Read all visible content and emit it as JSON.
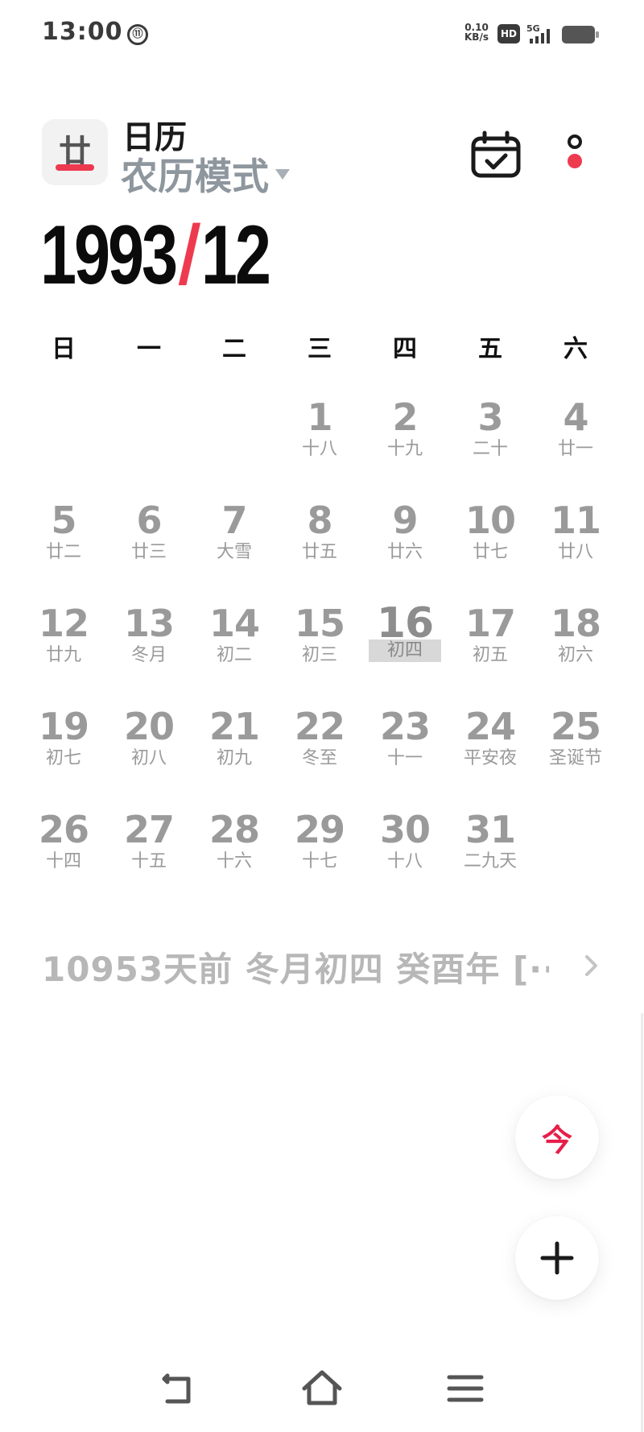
{
  "status_bar": {
    "time": "13:00",
    "time_badge": "⑪",
    "net_speed_value": "0.10",
    "net_speed_unit": "KB/s",
    "hd_label": "HD",
    "signal_label": "5G"
  },
  "header": {
    "app_icon_glyph": "廿",
    "app_title": "日历",
    "mode_label": "农历模式",
    "year": "1993",
    "month": "12",
    "accent_color": "#ee3a4f"
  },
  "weekdays": [
    "日",
    "一",
    "二",
    "三",
    "四",
    "五",
    "六"
  ],
  "calendar": {
    "leading_blanks": 3,
    "selected_day": "16",
    "days": [
      {
        "num": "1",
        "lunar": "十八"
      },
      {
        "num": "2",
        "lunar": "十九"
      },
      {
        "num": "3",
        "lunar": "二十"
      },
      {
        "num": "4",
        "lunar": "廿一"
      },
      {
        "num": "5",
        "lunar": "廿二"
      },
      {
        "num": "6",
        "lunar": "廿三"
      },
      {
        "num": "7",
        "lunar": "大雪"
      },
      {
        "num": "8",
        "lunar": "廿五"
      },
      {
        "num": "9",
        "lunar": "廿六"
      },
      {
        "num": "10",
        "lunar": "廿七"
      },
      {
        "num": "11",
        "lunar": "廿八"
      },
      {
        "num": "12",
        "lunar": "廿九"
      },
      {
        "num": "13",
        "lunar": "冬月"
      },
      {
        "num": "14",
        "lunar": "初二"
      },
      {
        "num": "15",
        "lunar": "初三"
      },
      {
        "num": "16",
        "lunar": "初四"
      },
      {
        "num": "17",
        "lunar": "初五"
      },
      {
        "num": "18",
        "lunar": "初六"
      },
      {
        "num": "19",
        "lunar": "初七"
      },
      {
        "num": "20",
        "lunar": "初八"
      },
      {
        "num": "21",
        "lunar": "初九"
      },
      {
        "num": "22",
        "lunar": "冬至"
      },
      {
        "num": "23",
        "lunar": "十一"
      },
      {
        "num": "24",
        "lunar": "平安夜"
      },
      {
        "num": "25",
        "lunar": "圣诞节"
      },
      {
        "num": "26",
        "lunar": "十四"
      },
      {
        "num": "27",
        "lunar": "十五"
      },
      {
        "num": "28",
        "lunar": "十六"
      },
      {
        "num": "29",
        "lunar": "十七"
      },
      {
        "num": "30",
        "lunar": "十八"
      },
      {
        "num": "31",
        "lunar": "二九天"
      }
    ]
  },
  "info_line": {
    "text": "10953天前  冬月初四  癸酉年  [···"
  },
  "fab": {
    "today_label": "今"
  },
  "icons": {
    "calendar_check": "calendar-check-icon",
    "more": "more-dots-icon",
    "add": "plus-icon",
    "chevron": "chevron-right-icon",
    "back": "back-icon",
    "home": "home-icon",
    "menu": "menu-icon"
  }
}
